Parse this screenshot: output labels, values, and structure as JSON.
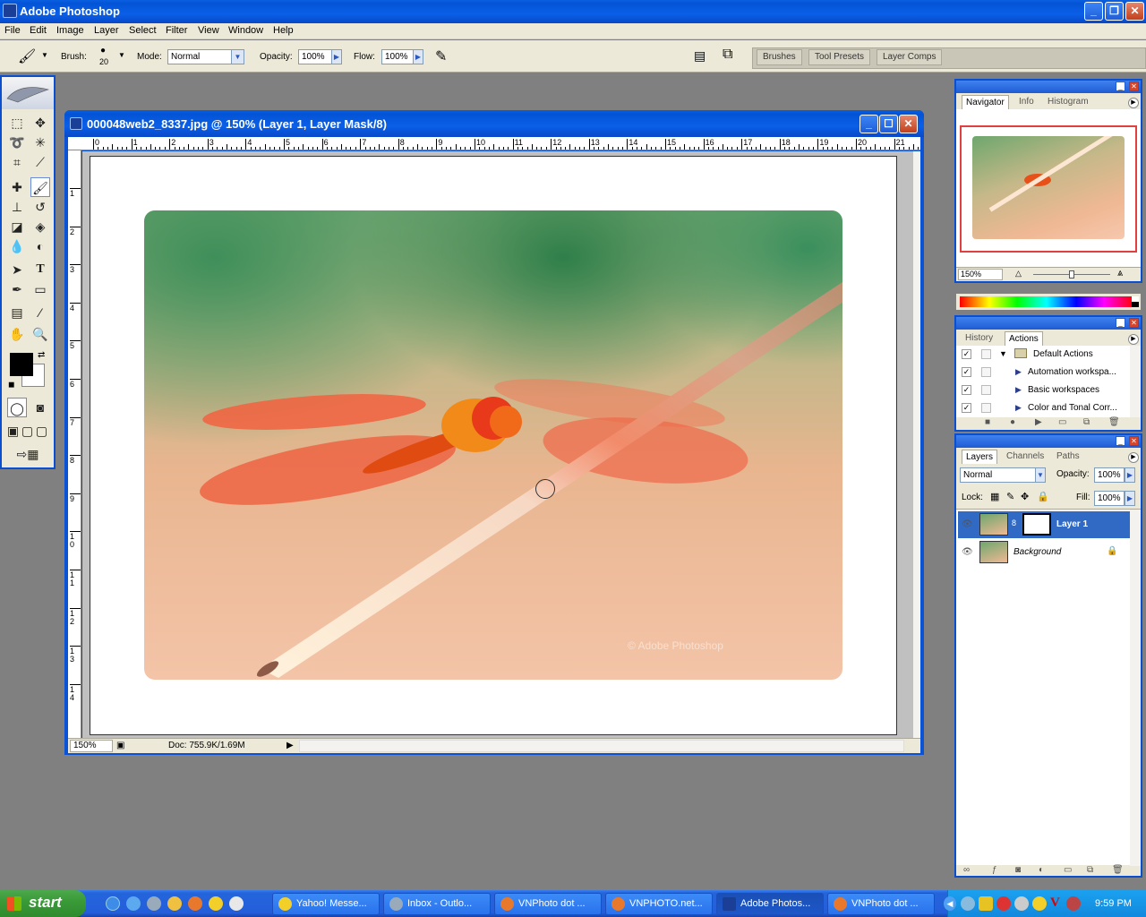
{
  "app": {
    "title": "Adobe Photoshop"
  },
  "menu": [
    "File",
    "Edit",
    "Image",
    "Layer",
    "Select",
    "Filter",
    "View",
    "Window",
    "Help"
  ],
  "options": {
    "brush_label": "Brush:",
    "brush_size": "20",
    "mode_label": "Mode:",
    "mode_value": "Normal",
    "opacity_label": "Opacity:",
    "opacity_value": "100%",
    "flow_label": "Flow:",
    "flow_value": "100%"
  },
  "palette_well": [
    "Brushes",
    "Tool Presets",
    "Layer Comps"
  ],
  "document": {
    "title": "000048web2_8337.jpg @ 150% (Layer 1, Layer Mask/8)",
    "ruler_top": [
      "0",
      "1",
      "2",
      "3",
      "4",
      "5",
      "6",
      "7",
      "8",
      "9",
      "10",
      "11",
      "12",
      "13",
      "14",
      "15",
      "16",
      "17",
      "18",
      "19",
      "20",
      "21"
    ],
    "ruler_left": [
      "1",
      "2",
      "3",
      "4",
      "5",
      "6",
      "7",
      "8",
      "9",
      "1 0",
      "1 1",
      "1 2",
      "1 3",
      "1 4"
    ],
    "zoom": "150%",
    "doc_size": "Doc: 755.9K/1.69M",
    "watermark": "© Adobe Photoshop"
  },
  "navigator": {
    "tabs": [
      "Navigator",
      "Info",
      "Histogram"
    ],
    "zoom": "150%"
  },
  "actions": {
    "tabs": [
      "History",
      "Actions"
    ],
    "rows": [
      "Default Actions",
      "Automation workspa...",
      "Basic workspaces",
      "Color and Tonal Corr..."
    ]
  },
  "layers": {
    "tabs": [
      "Layers",
      "Channels",
      "Paths"
    ],
    "blend_mode": "Normal",
    "opacity_label": "Opacity:",
    "opacity_value": "100%",
    "lock_label": "Lock:",
    "fill_label": "Fill:",
    "fill_value": "100%",
    "rows": [
      "Layer 1",
      "Background"
    ]
  },
  "taskbar": {
    "start": "start",
    "tasks": [
      "Yahoo! Messe...",
      "Inbox - Outlo...",
      "VNPhoto dot ...",
      "VNPHOTO.net...",
      "Adobe Photos...",
      "VNPhoto dot ..."
    ],
    "clock": "9:59 PM"
  }
}
